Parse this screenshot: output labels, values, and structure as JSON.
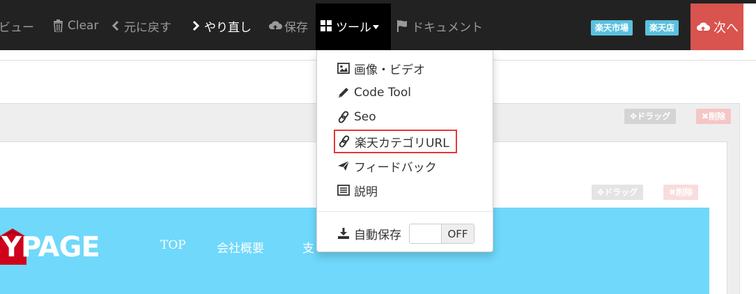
{
  "toolbar": {
    "preview_label": "ビュー",
    "clear_label": "Clear",
    "undo_label": "元に戻す",
    "redo_label": "やり直し",
    "save_label": "保存",
    "tools_label": "ツール",
    "docs_label": "ドキュメント",
    "badges": [
      "楽天市場",
      "楽天店"
    ],
    "next_label": "次へ"
  },
  "dropdown": {
    "items": [
      {
        "icon": "image-icon",
        "label": "画像・ビデオ"
      },
      {
        "icon": "pencil-icon",
        "label": "Code Tool"
      },
      {
        "icon": "link-icon",
        "label": "Seo"
      },
      {
        "icon": "link-icon",
        "label": "楽天カテゴリURL"
      },
      {
        "icon": "send-icon",
        "label": "フィードバック"
      },
      {
        "icon": "list-icon",
        "label": "説明"
      }
    ],
    "autosave_label": "自動保存",
    "autosave_state": "OFF"
  },
  "panels": {
    "drag_label": "ドラッグ",
    "delete_label": "削除"
  },
  "banner": {
    "logo_text": "YPAGE",
    "nav": [
      "TOP",
      "会社概要",
      "支"
    ]
  },
  "colors": {
    "toolbar_bg": "#222222",
    "accent_red": "#d9534f",
    "badge_blue": "#5bc0de",
    "banner_blue": "#6fd8fb",
    "highlight_red": "#e53935"
  }
}
